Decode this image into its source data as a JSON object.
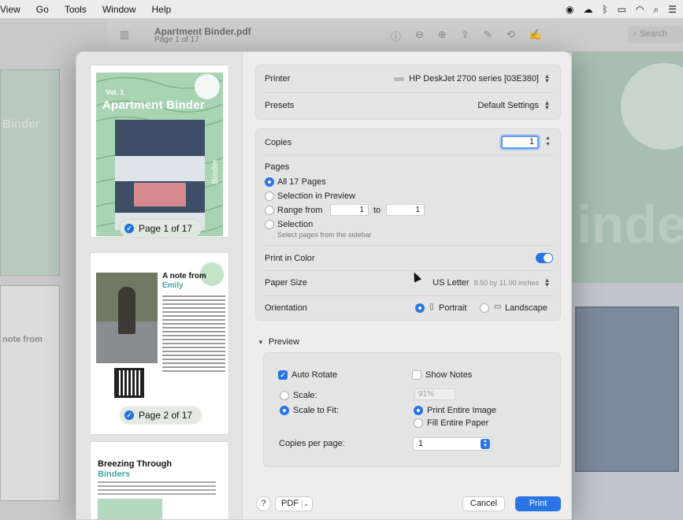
{
  "menubar": {
    "items": [
      "View",
      "Go",
      "Tools",
      "Window",
      "Help"
    ]
  },
  "document": {
    "title": "Apartment Binder.pdf",
    "page_info": "Page 1 of 17",
    "search_placeholder": "Search"
  },
  "background": {
    "big_word": "inde",
    "sidebar_word": "Binder",
    "sidebar_note": "note from"
  },
  "thumbnails": [
    {
      "vol": "Vol. 1",
      "title": "Apartment Binder",
      "side_word": "Binder",
      "badge": "Page 1 of 17"
    },
    {
      "title": "A note from",
      "name": "Emily",
      "badge": "Page 2 of 17"
    },
    {
      "title": "Breezing Through",
      "subtitle": "Binders"
    }
  ],
  "print": {
    "printer_label": "Printer",
    "printer_value": "HP DeskJet 2700 series [03E380]",
    "presets_label": "Presets",
    "presets_value": "Default Settings",
    "copies_label": "Copies",
    "copies_value": "1",
    "pages_label": "Pages",
    "pages_options": {
      "all": "All 17 Pages",
      "selection_preview": "Selection in Preview",
      "range": "Range from",
      "range_to": "to",
      "range_from_value": "1",
      "range_to_value": "1",
      "selection": "Selection",
      "selection_hint": "Select pages from the sidebar"
    },
    "print_in_color_label": "Print in Color",
    "paper_size_label": "Paper Size",
    "paper_size_value": "US Letter",
    "paper_size_dims": "8.50 by 11.00 inches",
    "orientation_label": "Orientation",
    "orientation_portrait": "Portrait",
    "orientation_landscape": "Landscape",
    "preview_label": "Preview",
    "auto_rotate": "Auto Rotate",
    "show_notes": "Show Notes",
    "scale_label": "Scale:",
    "scale_value": "91%",
    "scale_to_fit": "Scale to Fit:",
    "print_entire_image": "Print Entire Image",
    "fill_entire_paper": "Fill Entire Paper",
    "copies_per_page_label": "Copies per page:",
    "copies_per_page_value": "1",
    "help": "?",
    "pdf": "PDF",
    "cancel": "Cancel",
    "print": "Print"
  },
  "colors": {
    "accent": "#2a74e6",
    "cover_green": "#a9d4b4",
    "teal_text": "#4aa5a4"
  }
}
